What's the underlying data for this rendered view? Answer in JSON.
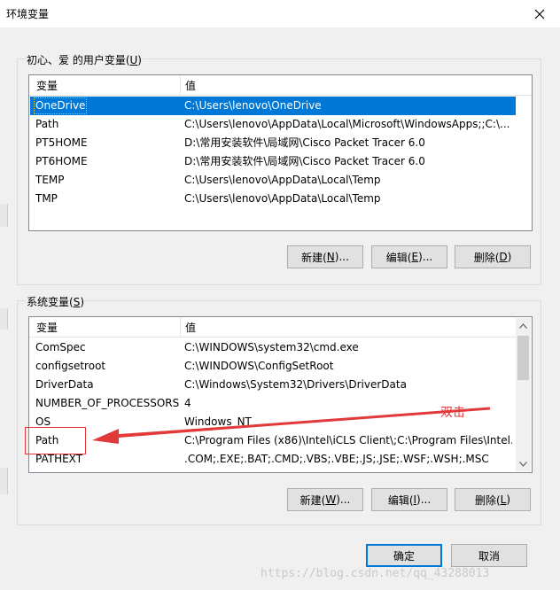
{
  "window": {
    "title": "环境变量",
    "close": "×"
  },
  "user_section": {
    "label_prefix": "初心、爱 的用户变量(",
    "label_accel": "U",
    "label_suffix": ")",
    "headers": [
      "变量",
      "值"
    ],
    "rows": [
      {
        "name": "OneDrive",
        "value": "C:\\Users\\lenovo\\OneDrive",
        "selected": true
      },
      {
        "name": "Path",
        "value": "C:\\Users\\lenovo\\AppData\\Local\\Microsoft\\WindowsApps;;C:\\..."
      },
      {
        "name": "PT5HOME",
        "value": "D:\\常用安装软件\\局域网\\Cisco Packet Tracer 6.0"
      },
      {
        "name": "PT6HOME",
        "value": "D:\\常用安装软件\\局域网\\Cisco Packet Tracer 6.0"
      },
      {
        "name": "TEMP",
        "value": "C:\\Users\\lenovo\\AppData\\Local\\Temp"
      },
      {
        "name": "TMP",
        "value": "C:\\Users\\lenovo\\AppData\\Local\\Temp"
      }
    ],
    "buttons": {
      "new": {
        "text": "新建(",
        "accel": "N",
        "suffix": ")..."
      },
      "edit": {
        "text": "编辑(",
        "accel": "E",
        "suffix": ")..."
      },
      "delete": {
        "text": "删除(",
        "accel": "D",
        "suffix": ")"
      }
    }
  },
  "system_section": {
    "label_prefix": "系统变量(",
    "label_accel": "S",
    "label_suffix": ")",
    "headers": [
      "变量",
      "值"
    ],
    "rows": [
      {
        "name": "ComSpec",
        "value": "C:\\WINDOWS\\system32\\cmd.exe"
      },
      {
        "name": "configsetroot",
        "value": "C:\\WINDOWS\\ConfigSetRoot"
      },
      {
        "name": "DriverData",
        "value": "C:\\Windows\\System32\\Drivers\\DriverData"
      },
      {
        "name": "NUMBER_OF_PROCESSORS",
        "value": "4"
      },
      {
        "name": "OS",
        "value": "Windows_NT"
      },
      {
        "name": "Path",
        "value": "C:\\Program Files (x86)\\Intel\\iCLS Client\\;C:\\Program Files\\Intel..."
      },
      {
        "name": "PATHEXT",
        "value": ".COM;.EXE;.BAT;.CMD;.VBS;.VBE;.JS;.JSE;.WSF;.WSH;.MSC"
      }
    ],
    "buttons": {
      "new": {
        "text": "新建(",
        "accel": "W",
        "suffix": ")..."
      },
      "edit": {
        "text": "编辑(",
        "accel": "I",
        "suffix": ")..."
      },
      "delete": {
        "text": "删除(",
        "accel": "L",
        "suffix": ")"
      }
    }
  },
  "footer": {
    "ok": "确定",
    "cancel": "取消"
  },
  "annotation": {
    "text": "双击"
  },
  "watermark": "https://blog.csdn.net/qq_43288013",
  "colors": {
    "selection": "#0078d7",
    "annotation": "#e23a3a",
    "focus_border": "#0078d7"
  }
}
